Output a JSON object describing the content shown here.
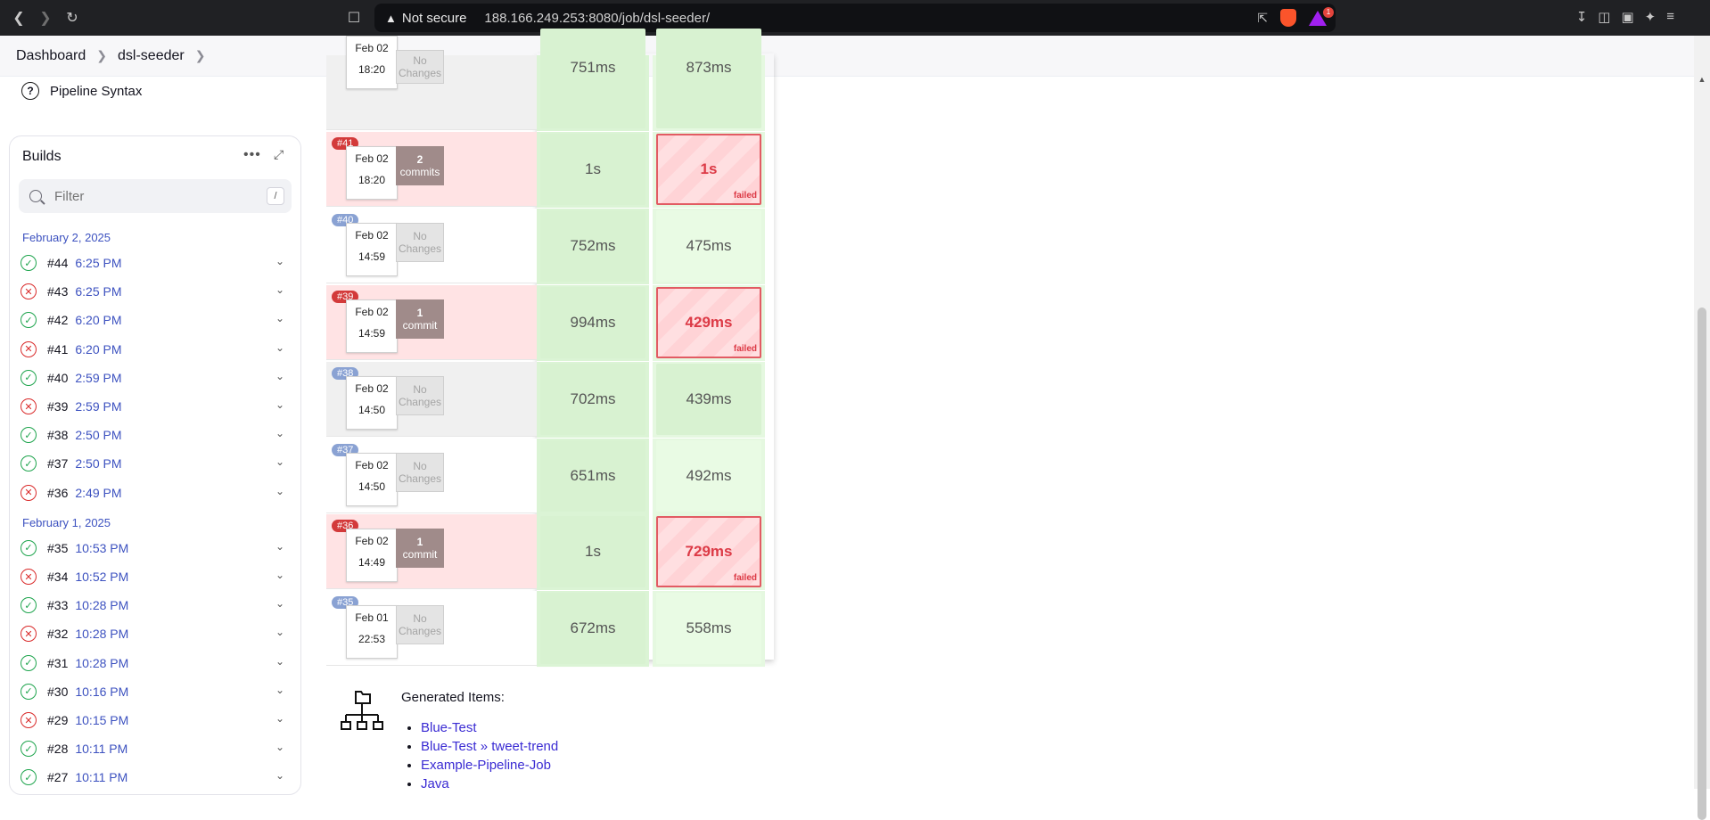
{
  "browser": {
    "security": "Not secure",
    "url": "188.166.249.253:8080/job/dsl-seeder/",
    "notification_count": "1"
  },
  "breadcrumb": {
    "items": [
      "Dashboard",
      "dsl-seeder"
    ]
  },
  "sidebar": {
    "pipeline_syntax": "Pipeline Syntax",
    "builds_title": "Builds",
    "filter_placeholder": "Filter",
    "filter_shortcut": "/",
    "groups": [
      {
        "date": "February 2, 2025",
        "builds": [
          {
            "num": "#44",
            "time": "6:25 PM",
            "status": "success"
          },
          {
            "num": "#43",
            "time": "6:25 PM",
            "status": "failed"
          },
          {
            "num": "#42",
            "time": "6:20 PM",
            "status": "success"
          },
          {
            "num": "#41",
            "time": "6:20 PM",
            "status": "failed"
          },
          {
            "num": "#40",
            "time": "2:59 PM",
            "status": "success"
          },
          {
            "num": "#39",
            "time": "2:59 PM",
            "status": "failed"
          },
          {
            "num": "#38",
            "time": "2:50 PM",
            "status": "success"
          },
          {
            "num": "#37",
            "time": "2:50 PM",
            "status": "success"
          },
          {
            "num": "#36",
            "time": "2:49 PM",
            "status": "failed"
          }
        ]
      },
      {
        "date": "February 1, 2025",
        "builds": [
          {
            "num": "#35",
            "time": "10:53 PM",
            "status": "success"
          },
          {
            "num": "#34",
            "time": "10:52 PM",
            "status": "failed"
          },
          {
            "num": "#33",
            "time": "10:28 PM",
            "status": "success"
          },
          {
            "num": "#32",
            "time": "10:28 PM",
            "status": "failed"
          },
          {
            "num": "#31",
            "time": "10:28 PM",
            "status": "success"
          },
          {
            "num": "#30",
            "time": "10:16 PM",
            "status": "success"
          },
          {
            "num": "#29",
            "time": "10:15 PM",
            "status": "failed"
          },
          {
            "num": "#28",
            "time": "10:11 PM",
            "status": "success"
          },
          {
            "num": "#27",
            "time": "10:11 PM",
            "status": "success"
          }
        ]
      }
    ]
  },
  "stage_view": {
    "rows": [
      {
        "num": "",
        "date": "Feb 02",
        "time": "18:20",
        "changes": "No Changes",
        "changes_kind": "none",
        "row_style": "gray",
        "stage1": "751ms",
        "stage2": "873ms",
        "stage2_failed": false
      },
      {
        "num": "#41",
        "date": "Feb 02",
        "time": "18:20",
        "changes_n": "2",
        "changes": "commits",
        "changes_kind": "commits",
        "row_style": "failed",
        "stage1": "1s",
        "stage2": "1s",
        "stage2_failed": true
      },
      {
        "num": "#40",
        "date": "Feb 02",
        "time": "14:59",
        "changes": "No Changes",
        "changes_kind": "none",
        "row_style": "white",
        "stage1": "752ms",
        "stage2": "475ms",
        "stage2_failed": false
      },
      {
        "num": "#39",
        "date": "Feb 02",
        "time": "14:59",
        "changes_n": "1",
        "changes": "commit",
        "changes_kind": "commits",
        "row_style": "failed",
        "stage1": "994ms",
        "stage2": "429ms",
        "stage2_failed": true
      },
      {
        "num": "#38",
        "date": "Feb 02",
        "time": "14:50",
        "changes": "No Changes",
        "changes_kind": "none",
        "row_style": "gray",
        "stage1": "702ms",
        "stage2": "439ms",
        "stage2_failed": false
      },
      {
        "num": "#37",
        "date": "Feb 02",
        "time": "14:50",
        "changes": "No Changes",
        "changes_kind": "none",
        "row_style": "white",
        "stage1": "651ms",
        "stage2": "492ms",
        "stage2_failed": false
      },
      {
        "num": "#36",
        "date": "Feb 02",
        "time": "14:49",
        "changes_n": "1",
        "changes": "commit",
        "changes_kind": "commits",
        "row_style": "failed",
        "stage1": "1s",
        "stage2": "729ms",
        "stage2_failed": true
      },
      {
        "num": "#35",
        "date": "Feb 01",
        "time": "22:53",
        "changes": "No Changes",
        "changes_kind": "none",
        "row_style": "white",
        "stage1": "672ms",
        "stage2": "558ms",
        "stage2_failed": false
      }
    ],
    "failed_label": "failed"
  },
  "generated": {
    "title": "Generated Items:",
    "items": [
      "Blue-Test",
      "Blue-Test » tweet-trend",
      "Example-Pipeline-Job",
      "Java"
    ]
  }
}
